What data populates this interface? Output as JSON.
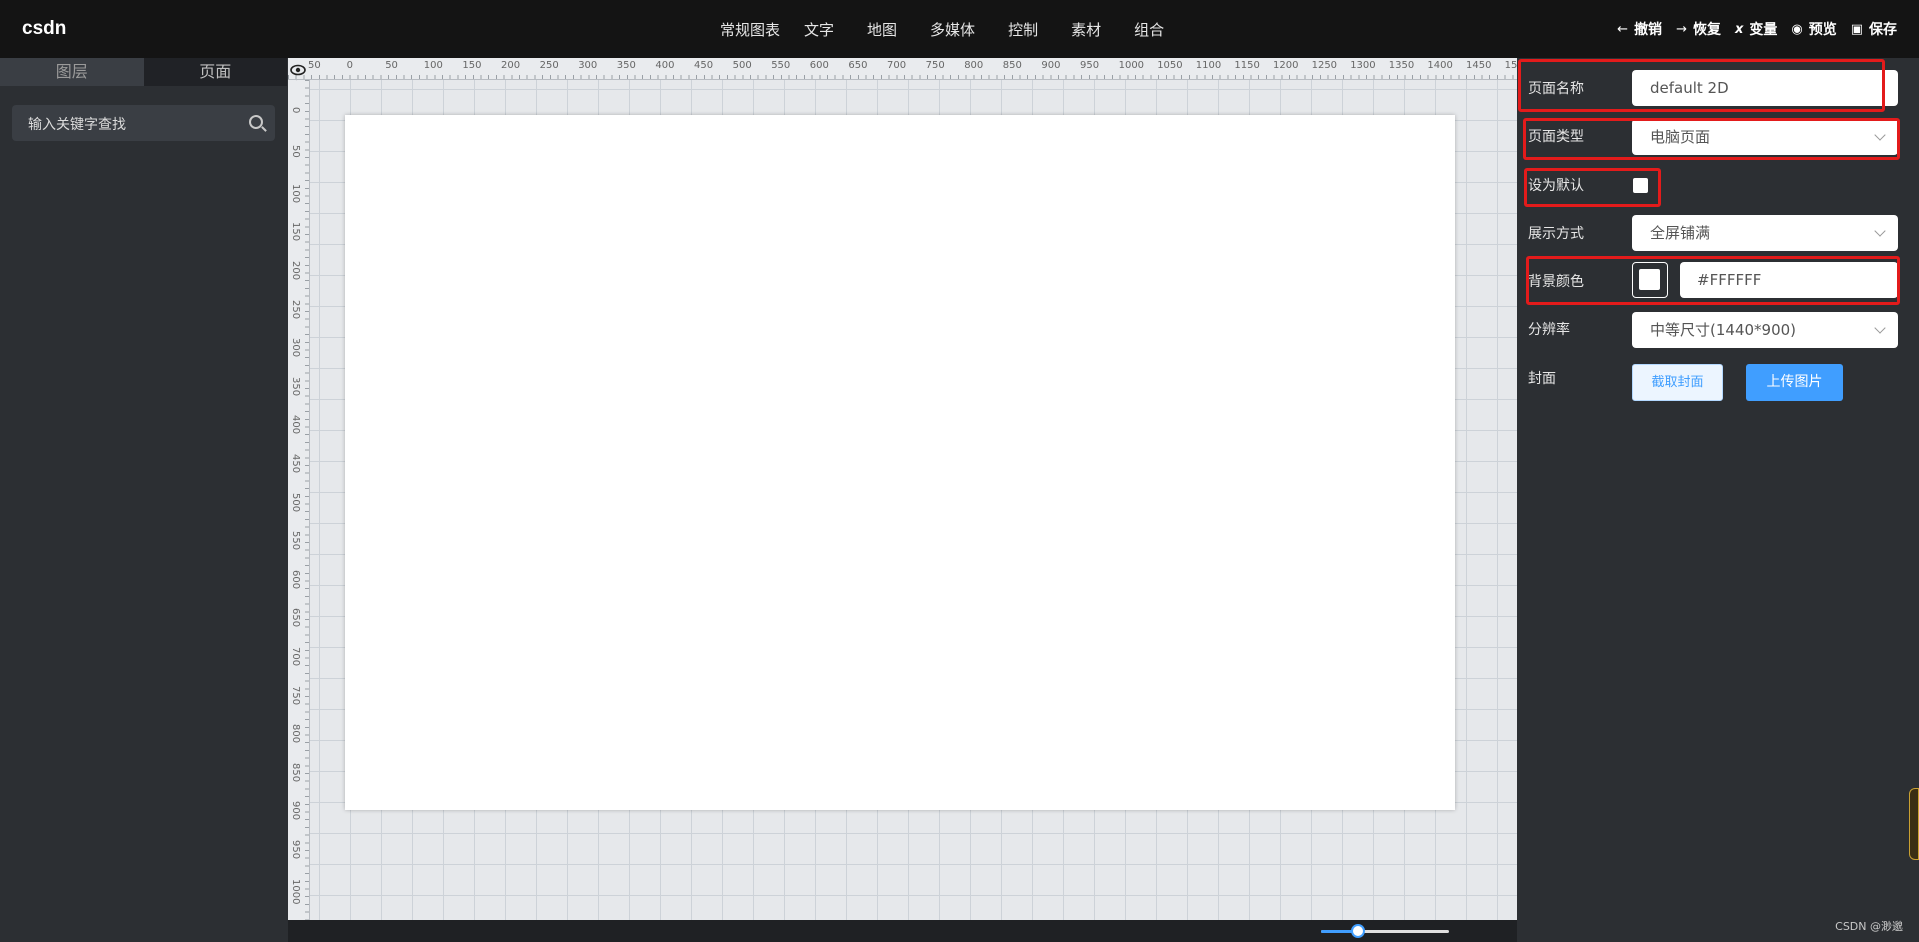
{
  "app": {
    "logo": "csdn"
  },
  "nav": {
    "items": [
      "常规图表",
      "文字",
      "地图",
      "多媒体",
      "控制",
      "素材",
      "组合"
    ]
  },
  "actions": {
    "undo": {
      "icon": "←",
      "label": "撤销"
    },
    "redo": {
      "icon": "→",
      "label": "恢复"
    },
    "variable": {
      "icon": "x",
      "label": "变量"
    },
    "preview": {
      "icon": "◉",
      "label": "预览"
    },
    "save": {
      "icon": "▣",
      "label": "保存"
    }
  },
  "left_panel": {
    "tabs": [
      "图层",
      "页面"
    ],
    "search_placeholder": "输入关键字查找"
  },
  "ruler": {
    "top": [
      "50",
      "0",
      "50",
      "100",
      "150",
      "200",
      "250",
      "300",
      "350",
      "400",
      "450",
      "500",
      "550",
      "600",
      "650",
      "700",
      "750",
      "800",
      "850",
      "900",
      "950",
      "1000",
      "1050",
      "1100",
      "1150",
      "1200",
      "1250",
      "1300",
      "1350",
      "1400",
      "1450",
      "15"
    ],
    "left": [
      "50",
      "0",
      "50",
      "100",
      "150",
      "200",
      "250",
      "300",
      "350",
      "400",
      "450",
      "500",
      "550",
      "600",
      "650",
      "700",
      "750",
      "800",
      "850",
      "900",
      "950",
      "1000"
    ]
  },
  "properties": {
    "page_name": {
      "label": "页面名称",
      "value": "default 2D"
    },
    "page_type": {
      "label": "页面类型",
      "value": "电脑页面"
    },
    "set_default": {
      "label": "设为默认",
      "checked": false
    },
    "display_mode": {
      "label": "展示方式",
      "value": "全屏铺满"
    },
    "background_color": {
      "label": "背景颜色",
      "value": "#FFFFFF"
    },
    "resolution": {
      "label": "分辨率",
      "value": "中等尺寸(1440*900)"
    },
    "cover": {
      "label": "封面",
      "capture_button": "截取封面",
      "upload_button": "上传图片"
    }
  },
  "zoom": {
    "level": 0.3
  },
  "colors": {
    "accent": "#409eff",
    "highlight": "#e31b1b",
    "topbar": "#141414",
    "panel": "#2c2f33"
  },
  "watermark": "CSDN @渺邈"
}
